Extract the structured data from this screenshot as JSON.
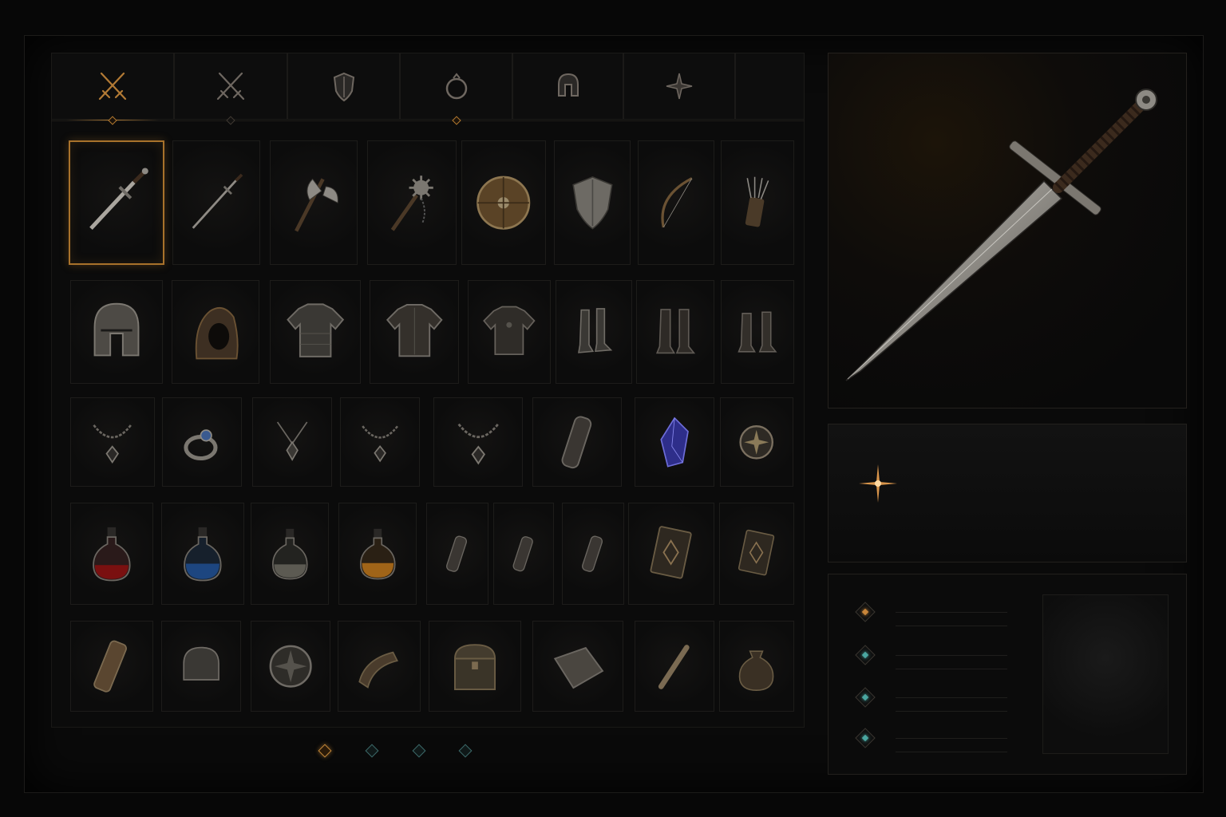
{
  "screen": {
    "title": ""
  },
  "tabs": [
    {
      "icon": "crossed-swords-icon",
      "active": true
    },
    {
      "icon": "crossed-swords-icon",
      "active": false
    },
    {
      "icon": "shield-icon",
      "active": false
    },
    {
      "icon": "ring-icon",
      "active": false
    },
    {
      "icon": "helmet-icon",
      "active": false
    },
    {
      "icon": "compass-star-icon",
      "active": false
    },
    {
      "icon": "",
      "active": false
    }
  ],
  "inventory": {
    "rows": [
      [
        "longsword",
        "rapier",
        "battle-axe",
        "flail",
        "round-shield",
        "kite-shield",
        "longbow",
        "quiver"
      ],
      [
        "great-helm",
        "hood",
        "chainmail-armor",
        "plate-armor",
        "leather-armor",
        "iron-boots",
        "leather-boots",
        "tall-boots"
      ],
      [
        "amulet",
        "sapphire-ring",
        "pendant",
        "amulet",
        "amulet",
        "scroll-case",
        "sapphire-gem",
        "compass-coin"
      ],
      [
        "red-potion",
        "blue-potion",
        "clear-potion",
        "amber-potion",
        "scroll-case",
        "scroll-case",
        "scroll-case",
        "rune-tome",
        "rune-tome"
      ],
      [
        "scroll",
        "iron-cap",
        "shield-emblem",
        "horn",
        "small-chest",
        "cloth",
        "bone",
        "coin-pouch"
      ]
    ],
    "selected_item": "longsword"
  },
  "pager": {
    "pages": 4,
    "current": 1
  },
  "preview": {
    "item_icon": "longsword-icon"
  },
  "info": {
    "icon": "sparkle-star-icon"
  },
  "stats": {
    "rows": [
      {
        "gem": "gold",
        "text": ""
      },
      {
        "gem": "teal",
        "text": ""
      },
      {
        "gem": "teal",
        "text": ""
      },
      {
        "gem": "teal",
        "text": ""
      }
    ]
  },
  "colors": {
    "accent": "#a8722b",
    "teal": "#4aa6a0",
    "background": "#070707"
  }
}
